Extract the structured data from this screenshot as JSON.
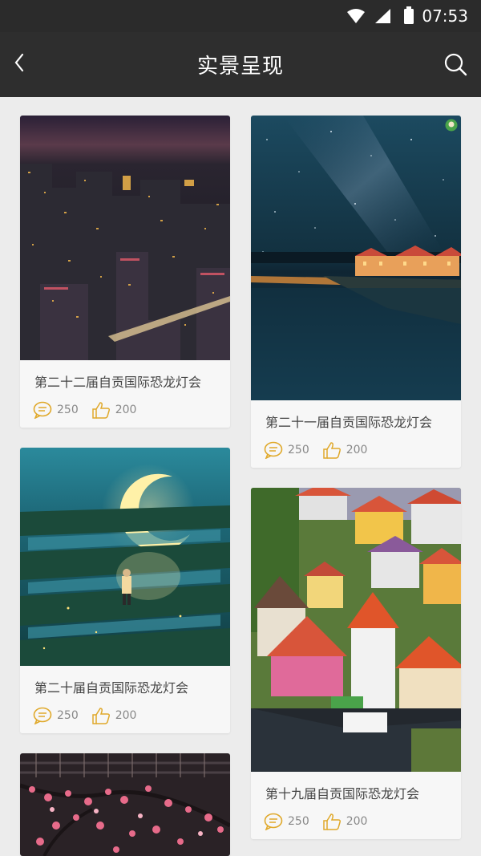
{
  "status_bar": {
    "time": "07:53"
  },
  "app_bar": {
    "title": "实景呈现"
  },
  "cards": [
    {
      "title": "第二十二届自贡国际恐龙灯会",
      "comments": "250",
      "likes": "200"
    },
    {
      "title": "第二十一届自贡国际恐龙灯会",
      "comments": "250",
      "likes": "200"
    },
    {
      "title": "第二十届自贡国际恐龙灯会",
      "comments": "250",
      "likes": "200"
    },
    {
      "title": "第十九届自贡国际恐龙灯会",
      "comments": "250",
      "likes": "200"
    }
  ],
  "icons": {
    "back": "chevron-left-icon",
    "search": "search-icon",
    "comment": "comment-icon",
    "like": "thumbs-up-icon"
  },
  "colors": {
    "status_bar": "#2b2b2b",
    "app_bar": "#2e2e2e",
    "background": "#ececec",
    "icon_accent": "#e0a92b"
  }
}
